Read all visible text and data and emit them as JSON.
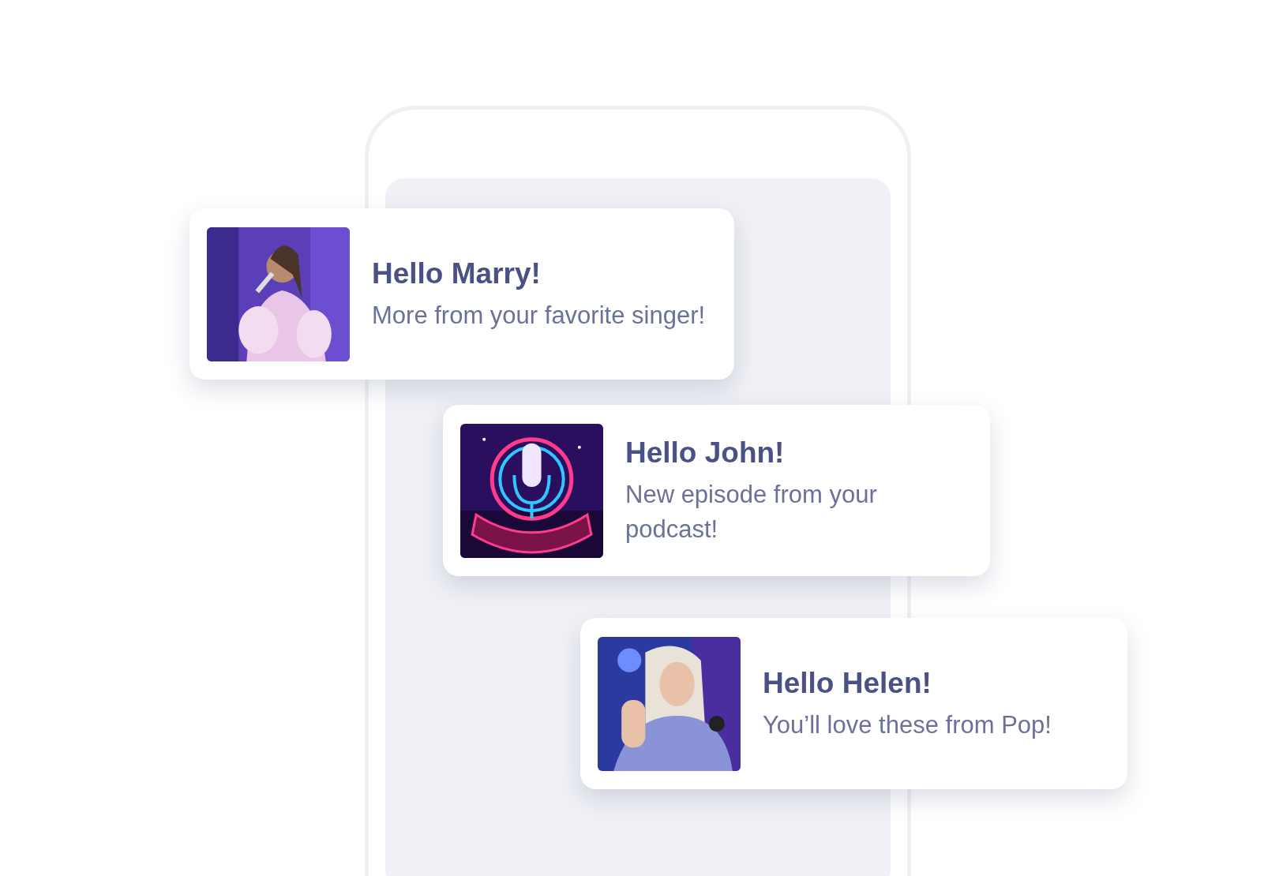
{
  "notifications": [
    {
      "title": "Hello Marry!",
      "message": "More from your favorite singer!"
    },
    {
      "title": "Hello John!",
      "message": "New episode from your podcast!"
    },
    {
      "title": "Hello Helen!",
      "message": "You’ll love these from Pop!"
    }
  ]
}
